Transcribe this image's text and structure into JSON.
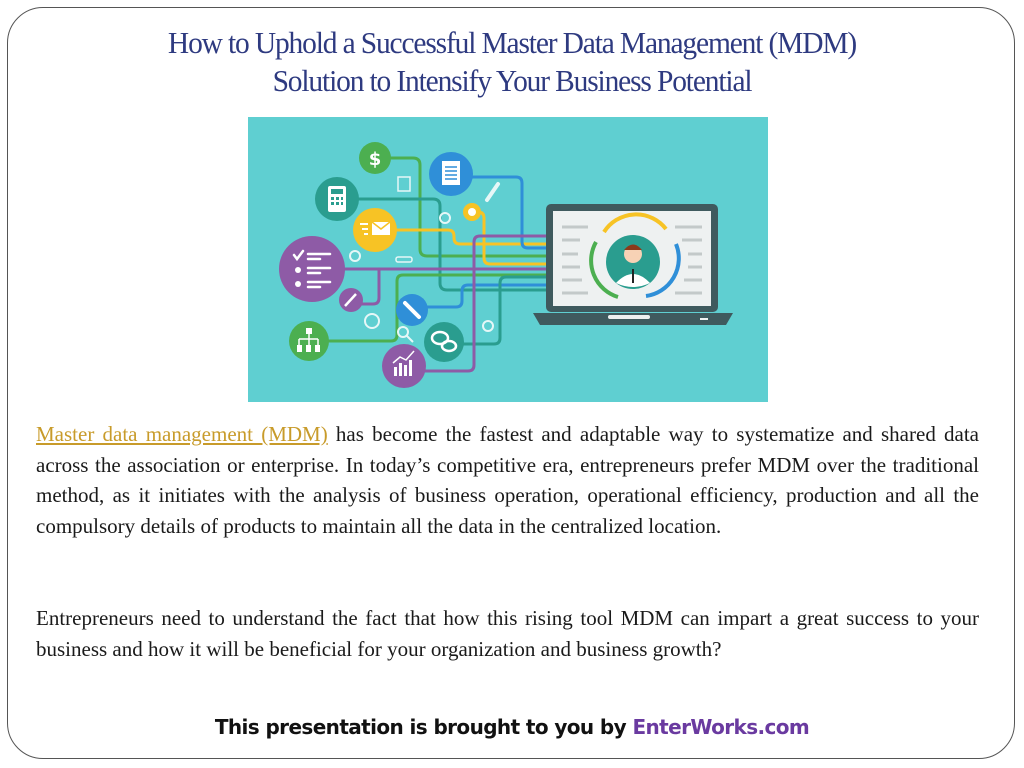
{
  "slide": {
    "title_line1": "How to Uphold a Successful Master Data Management (MDM)",
    "title_line2": "Solution to Intensify Your Business Potential",
    "hero_image": {
      "description": "MDM illustration: colored circular icons connected by lines to a laptop showing a user avatar with circular arrows",
      "icons": [
        "dollar-icon",
        "document-icon",
        "calculator-icon",
        "email-icon",
        "gear-icon",
        "pencil-icon",
        "checklist-icon",
        "edit-icon",
        "org-chart-icon",
        "attachment-icon",
        "search-icon",
        "chat-icon",
        "analytics-chart-icon",
        "laptop-icon",
        "user-avatar-icon",
        "sync-arrows-icon"
      ],
      "colors": {
        "background": "#5fcfd1",
        "green": "#4caf50",
        "teal": "#2a9d8f",
        "blue": "#2f8fd8",
        "yellow": "#f7c325",
        "purple": "#8e5ba6",
        "laptop": "#3f5a5e"
      }
    },
    "paragraph1": {
      "link_text": "Master data management (MDM)",
      "text": " has become the fastest and adaptable way to systematize and shared data across the association or enterprise. In today’s competitive era, entrepreneurs prefer MDM over the traditional method, as it initiates with the analysis of  business operation, operational efficiency, production and all the compulsory details of  products to maintain all the data in the centralized location."
    },
    "paragraph2": "Entrepreneurs need to understand the fact that how this rising tool MDM can impart a great success to your business and how it will be beneficial for your organization and business growth?",
    "footer": {
      "prefix": "This presentation is brought to you by ",
      "brand": "EnterWorks.com"
    },
    "colors": {
      "title": "#2e3a80",
      "link": "#c89b2a",
      "brand": "#6a3aa0",
      "body_text": "#1a1a1a"
    }
  }
}
